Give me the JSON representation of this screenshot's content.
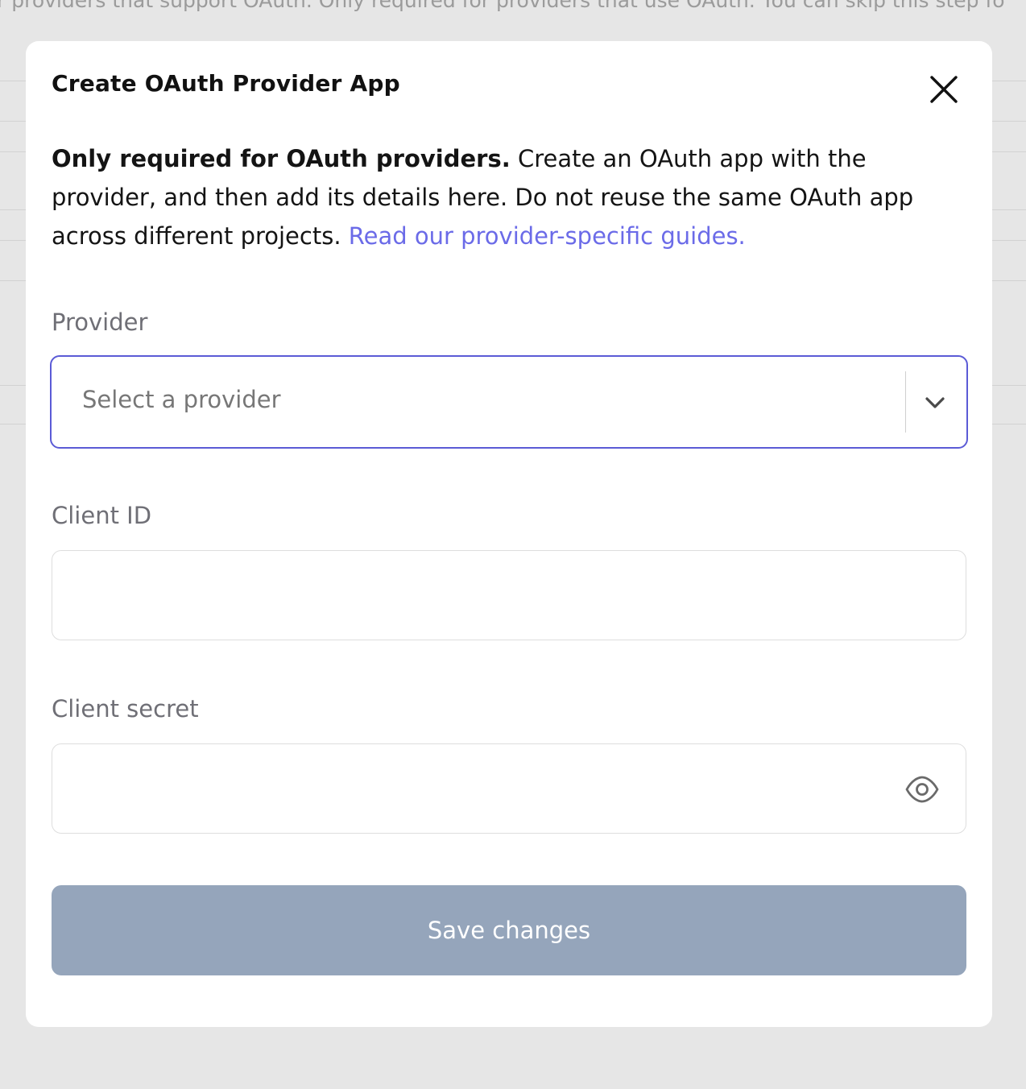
{
  "background": {
    "text": "r providers that support OAuth. Only required for providers that use OAuth. You can skip this step fo"
  },
  "modal": {
    "title": "Create OAuth Provider App",
    "close_icon": "close-icon",
    "description": {
      "bold": "Only required for OAuth providers.",
      "text": " Create an OAuth app with the provider, and then add its details here. Do not reuse the same OAuth app across different projects. ",
      "link": "Read our provider-specific guides."
    },
    "fields": {
      "provider": {
        "label": "Provider",
        "placeholder": "Select a provider",
        "icon": "chevron-down-icon"
      },
      "client_id": {
        "label": "Client ID",
        "value": ""
      },
      "client_secret": {
        "label": "Client secret",
        "value": "",
        "icon": "eye-icon"
      }
    },
    "save_label": "Save changes"
  },
  "colors": {
    "accent": "#5b5bd6",
    "link": "#6b6be8",
    "button_disabled": "#95a5bb",
    "overlay": "#e6e6e6"
  }
}
